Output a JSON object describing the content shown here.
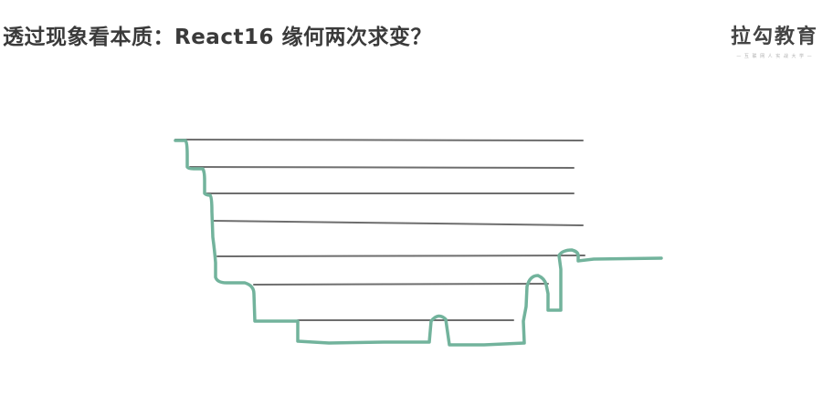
{
  "header": {
    "title": "透过现象看本质：React16 缘何两次求变？"
  },
  "brand": {
    "name": "拉勾教育",
    "tagline": "— 互 联 网 人 实 战 大 学 —"
  },
  "colors": {
    "line_gray": "#6e6e6e",
    "outline_green": "#72b39c",
    "title_text": "#3a3a3a"
  }
}
